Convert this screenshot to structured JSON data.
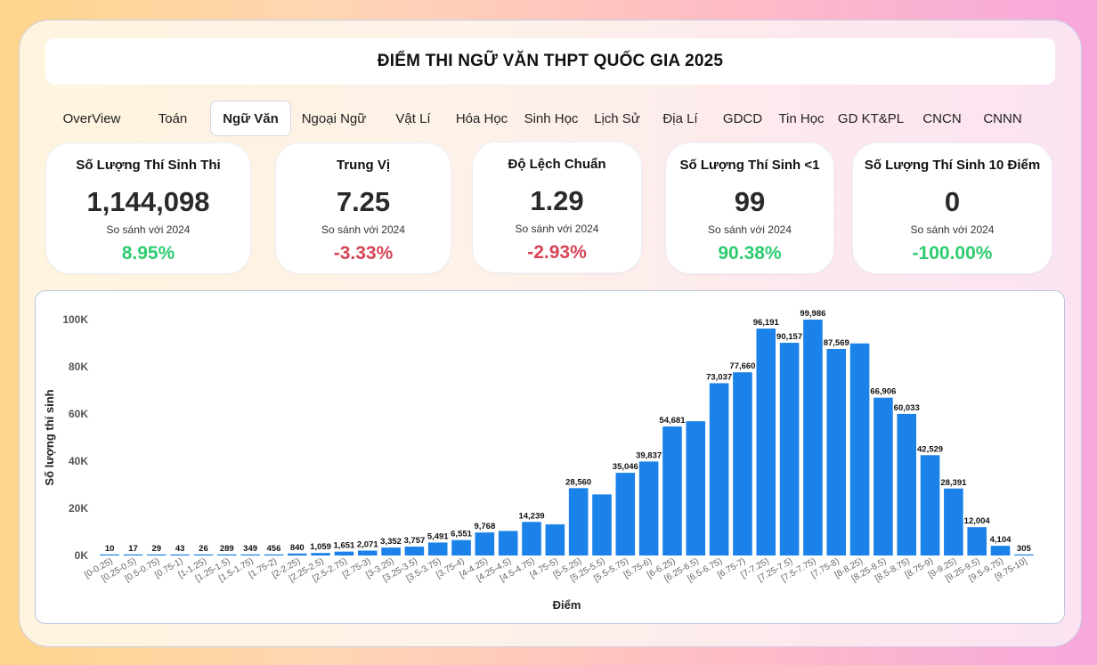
{
  "title": "ĐIỂM THI NGỮ VĂN THPT QUỐC GIA 2025",
  "tabs": [
    "OverView",
    "Toán",
    "Ngữ Văn",
    "Ngoại Ngữ",
    "Vật Lí",
    "Hóa Học",
    "Sinh Học",
    "Lịch Sử",
    "Địa Lí",
    "GDCD",
    "Tin Học",
    "GD KT&PL",
    "CNCN",
    "CNNN"
  ],
  "active_tab": "Ngữ Văn",
  "kpis": [
    {
      "title": "Số Lượng Thí Sinh Thi",
      "value": "1,144,098",
      "compare": "So sánh với 2024",
      "delta": "8.95%",
      "trend": "pos"
    },
    {
      "title": "Trung Vị",
      "value": "7.25",
      "compare": "So sánh với 2024",
      "delta": "-3.33%",
      "trend": "neg"
    },
    {
      "title": "Độ Lệch Chuẩn",
      "value": "1.29",
      "compare": "So sánh với 2024",
      "delta": "-2.93%",
      "trend": "neg"
    },
    {
      "title": "Số Lượng Thí Sinh <1",
      "value": "99",
      "compare": "So sánh với 2024",
      "delta": "90.38%",
      "trend": "pos"
    },
    {
      "title": "Số Lượng Thí Sinh 10 Điểm",
      "value": "0",
      "compare": "So sánh với 2024",
      "delta": "-100.00%",
      "trend": "pos"
    }
  ],
  "colors": {
    "bar": "#1a82e8",
    "positive": "#2ecc71",
    "negative": "#d64556"
  },
  "chart_data": {
    "type": "bar",
    "xlabel": "Điểm",
    "ylabel": "Số lượng thí sinh",
    "ylim": [
      0,
      100000
    ],
    "yticks": [
      0,
      20000,
      40000,
      60000,
      80000,
      100000
    ],
    "ytick_labels": [
      "0K",
      "20K",
      "40K",
      "60K",
      "80K",
      "100K"
    ],
    "categories": [
      "[0-0.25)",
      "[0.25-0.5)",
      "[0.5-0.75)",
      "[0.75-1)",
      "[1-1.25)",
      "[1.25-1.5)",
      "[1.5-1.75)",
      "[1.75-2)",
      "[2-2.25)",
      "[2.25-2.5)",
      "[2.5-2.75)",
      "[2.75-3)",
      "[3-3.25)",
      "[3.25-3.5)",
      "[3.5-3.75)",
      "[3.75-4)",
      "[4-4.25)",
      "[4.25-4.5)",
      "[4.5-4.75)",
      "[4.75-5)",
      "[5-5.25)",
      "[5.25-5.5)",
      "[5.5-5.75)",
      "[5.75-6)",
      "[6-6.25)",
      "[6.25-6.5)",
      "[6.5-6.75)",
      "[6.75-7)",
      "[7-7.25)",
      "[7.25-7.5)",
      "[7.5-7.75)",
      "[7.75-8)",
      "[8-8.25)",
      "[8.25-8.5)",
      "[8.5-8.75)",
      "[8.75-9)",
      "[9-9.25)",
      "[9.25-9.5)",
      "[9.5-9.75)",
      "[9.75-10]"
    ],
    "values": [
      10,
      17,
      29,
      43,
      26,
      289,
      349,
      456,
      840,
      1059,
      1651,
      2071,
      3352,
      3757,
      5491,
      6551,
      9768,
      10400,
      14239,
      13200,
      28560,
      25900,
      35046,
      39837,
      54681,
      56900,
      73037,
      77660,
      96191,
      90157,
      99986,
      87569,
      89900,
      66906,
      60033,
      42529,
      28391,
      12004,
      4104,
      305
    ],
    "data_labels": [
      "10",
      "17",
      "29",
      "43",
      "26",
      "289",
      "349",
      "456",
      "840",
      "1,059",
      "1,651",
      "2,071",
      "3,352",
      "3,757",
      "5,491",
      "6,551",
      "9,768",
      "",
      "14,239",
      "",
      "28,560",
      "",
      "35,046",
      "39,837",
      "54,681",
      "",
      "73,037",
      "77,660",
      "96,191",
      "90,157",
      "99,986",
      "87,569",
      "",
      "66,906",
      "60,033",
      "42,529",
      "28,391",
      "12,004",
      "4,104",
      "305"
    ]
  }
}
